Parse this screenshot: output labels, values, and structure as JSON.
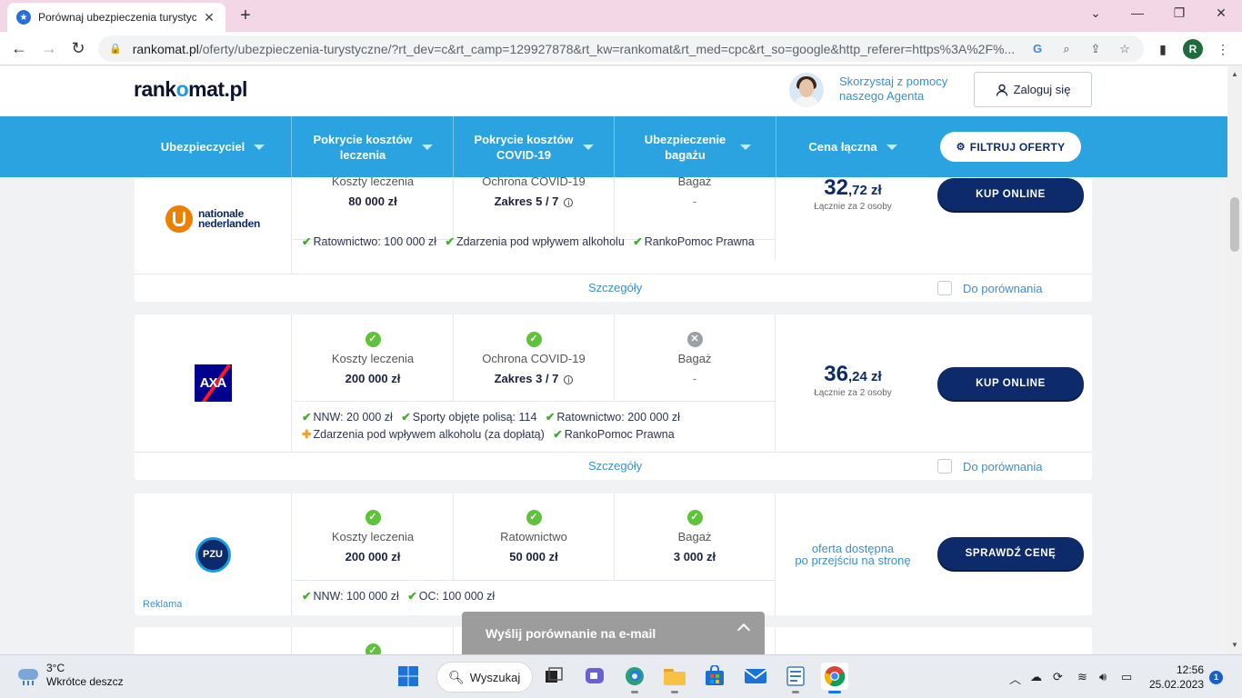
{
  "browser": {
    "tab_title": "Porównaj ubezpieczenia turystyc",
    "tab_close": "✕",
    "new_tab": "+",
    "url_host": "rankomat.pl",
    "url_path": "/oferty/ubezpieczenia-turystyczne/?rt_dev=c&rt_camp=129927878&rt_kw=rankomat&rt_med=cpc&rt_so=google&http_referer=https%3A%2F%...",
    "profile_initial": "R"
  },
  "site": {
    "logo_left": "rank",
    "logo_o": "o",
    "logo_right": "mat.pl",
    "agent_line1": "Skorzystaj z pomocy",
    "agent_line2": "naszego Agenta",
    "login_label": "Zaloguj się"
  },
  "filter_bar": {
    "columns": [
      {
        "label": "Ubezpieczyciel"
      },
      {
        "label": "Pokrycie kosztów leczenia"
      },
      {
        "label": "Pokrycie kosztów COVID-19"
      },
      {
        "label": "Ubezpieczenie bagażu"
      },
      {
        "label": "Cena łączna"
      }
    ],
    "filter_button": "FILTRUJ OFERTY"
  },
  "offers": [
    {
      "insurer": "nationale nederlanden",
      "logo_line1": "nationale",
      "logo_line2": "nederlanden",
      "coverage": [
        {
          "label": "Koszty leczenia",
          "value": "80 000 zł",
          "status": "ok"
        },
        {
          "label": "Ochrona COVID-19",
          "value": "Zakres 5 / 7",
          "status": "ok"
        },
        {
          "label": "Bagaż",
          "value": "-",
          "status": "no"
        }
      ],
      "features": [
        "Ratownictwo: 100 000 zł",
        "Zdarzenia pod wpływem alkoholu",
        "RankoPomoc Prawna"
      ],
      "price_main": "32",
      "price_decimal": ",72 zł",
      "price_note": "Łącznie za 2 osoby",
      "button": "KUP ONLINE",
      "details": "Szczegóły",
      "compare": "Do porównania"
    },
    {
      "insurer": "AXA",
      "logo_text": "AXA",
      "coverage": [
        {
          "label": "Koszty leczenia",
          "value": "200 000 zł",
          "status": "ok"
        },
        {
          "label": "Ochrona COVID-19",
          "value": "Zakres 3 / 7",
          "status": "ok"
        },
        {
          "label": "Bagaż",
          "value": "-",
          "status": "no"
        }
      ],
      "features": [
        "NNW: 20 000 zł",
        "Sporty objęte polisą: 114",
        "Ratownictwo: 200 000 zł"
      ],
      "features_extra": [
        "Zdarzenia pod wpływem alkoholu (za dopłatą)",
        "RankoPomoc Prawna"
      ],
      "price_main": "36",
      "price_decimal": ",24 zł",
      "price_note": "Łącznie za 2 osoby",
      "button": "KUP ONLINE",
      "details": "Szczegóły",
      "compare": "Do porównania"
    },
    {
      "insurer": "PZU",
      "logo_text": "PZU",
      "coverage": [
        {
          "label": "Koszty leczenia",
          "value": "200 000 zł",
          "status": "ok"
        },
        {
          "label": "Ratownictwo",
          "value": "50 000 zł",
          "status": "ok"
        },
        {
          "label": "Bagaż",
          "value": "3 000 zł",
          "status": "ok"
        }
      ],
      "features": [
        "NNW: 100 000 zł",
        "OC: 100 000 zł"
      ],
      "price_line1": "oferta dostępna",
      "price_line2": "po przejściu na stronę",
      "button": "SPRAWDŹ CENĘ",
      "ad_label": "Reklama"
    }
  ],
  "email_bar": {
    "label": "Wyślij porównanie na e-mail"
  },
  "taskbar": {
    "temp": "3°C",
    "weather": "Wkrótce deszcz",
    "search": "Wyszukaj",
    "time": "12:56",
    "date": "25.02.2023",
    "notifications": "1"
  },
  "colors": {
    "brand_blue": "#2aa3e0",
    "navy": "#0d2b6b",
    "ok_green": "#5ec23a"
  }
}
